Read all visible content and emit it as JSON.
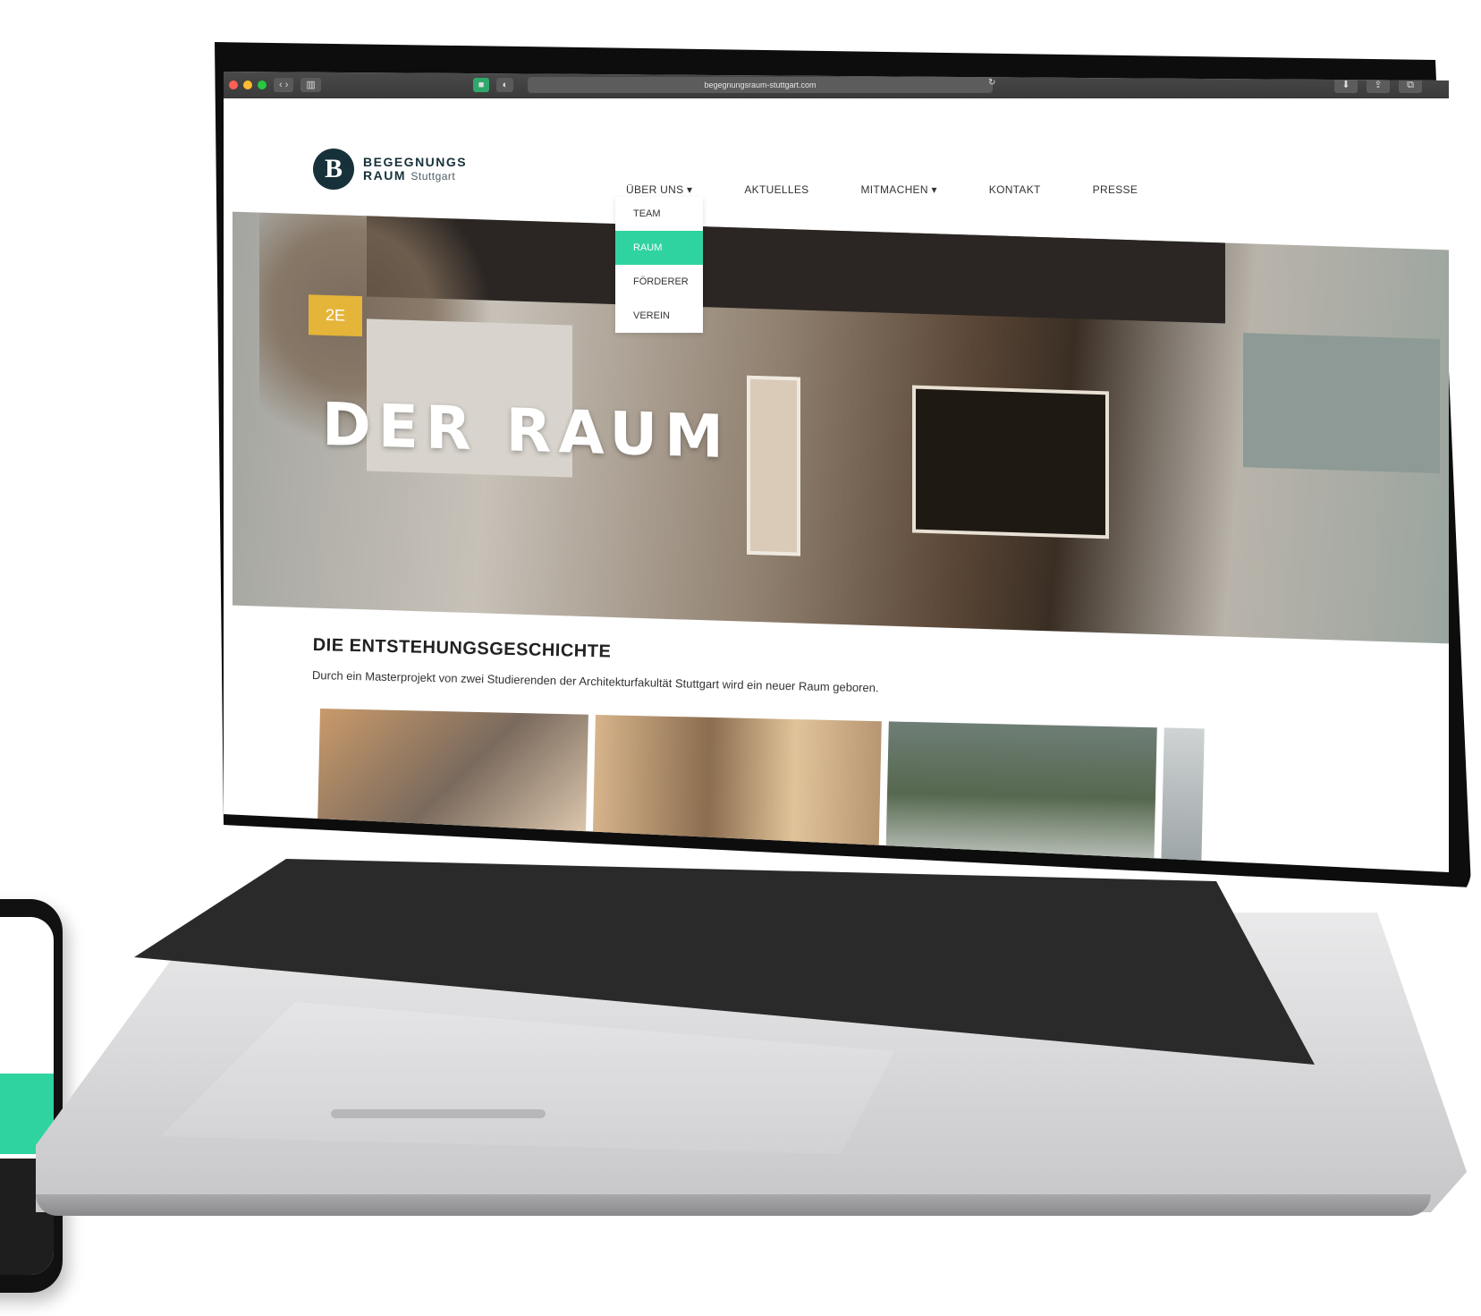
{
  "browser": {
    "url": "begegnungsraum-stuttgart.com",
    "colors": {
      "traffic_red": "#ff5f57",
      "traffic_yellow": "#febc2e",
      "traffic_green": "#28c840"
    }
  },
  "site": {
    "logo": {
      "mark": "B",
      "line1": "BEGEGNUNGS",
      "line2": "RAUM",
      "line2_small": "Stuttgart"
    },
    "nav": [
      {
        "label": "ÜBER UNS ▾"
      },
      {
        "label": "AKTUELLES"
      },
      {
        "label": "MITMACHEN ▾"
      },
      {
        "label": "KONTAKT"
      },
      {
        "label": "PRESSE"
      }
    ],
    "dropdown": [
      {
        "label": "TEAM"
      },
      {
        "label": "RAUM"
      },
      {
        "label": "FÖRDERER"
      },
      {
        "label": "VEREIN"
      }
    ],
    "accent_color": "#2fd3a0"
  },
  "hero": {
    "title": "DER RAUM",
    "sign_text": "2E"
  },
  "content": {
    "section_title": "DIE ENTSTEHUNGSGESCHICHTE",
    "section_text": "Durch ein Masterprojekt von zwei Studierenden der Architekturfakultät Stuttgart wird ein neuer Raum geboren."
  }
}
